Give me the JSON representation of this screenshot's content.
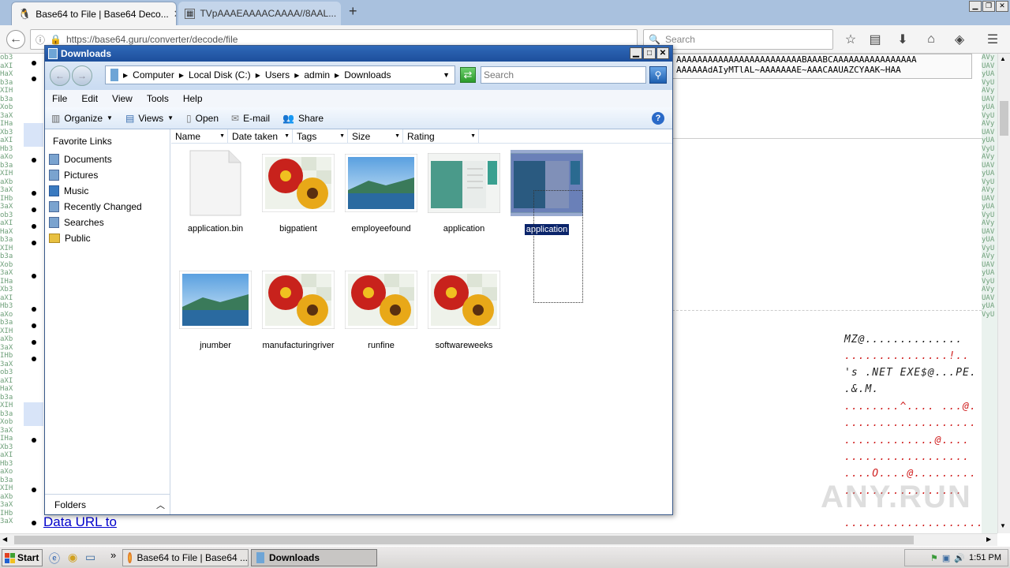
{
  "browser": {
    "tabs": [
      {
        "label": "Base64 to File | Base64 Deco...",
        "active": true
      },
      {
        "label": "TVpAAAEAAAACAAAA//8AAL...",
        "active": false
      }
    ],
    "new_tab_label": "+",
    "url": "https://base64.guru/converter/decode/file",
    "search_placeholder": "Search"
  },
  "page": {
    "left_col_text": "ob3aXIHaXb3aXIHb3aXob3aXIHaXb3aXIHb3aXob3aXIHaXb3aXIHb3aXob3aXIHaXb3aXIHb3aXob3aXIHaXb3aXIHb3aXob3aXIHaXb3aXIHb3aXob3aXIHaXb3aXIHb3aXob3aXIHaXb3aXIHb3aXob3aXIHaXb3aXIHb3aX",
    "right_col_text": "AVyUAVyUAVyUAVyUAVyUAVyUAVyUAVyUAVyUAVyUAVyUAVyUAVyUAVyUAVyUAVyUAVyUAVyUAVyUAVyUAVyUAVyUAVyUAVyU",
    "b64_line1": "AAAAAAAAAAAAAAAAAAAAAAAABAAABCAAAAAAAAAAAAAAAA",
    "b64_line2": "AAAAAAdAIyMTlAL~AAAAAAAE~AAACAAUAZCYAAK~HAA",
    "hex_lines": [
      "MZ@..............",
      "...............!..",
      "'s .NET EXE$@...PE.",
      ".&.M.",
      "........^....  ...@.",
      "...................",
      ".............@....",
      "..................",
      "....O....@.........",
      ".................",
      "...................."
    ],
    "data_url_link": "Data URL to",
    "watermark": "ANY.RUN"
  },
  "explorer": {
    "title": "Downloads",
    "breadcrumb": [
      "Computer",
      "Local Disk (C:)",
      "Users",
      "admin",
      "Downloads"
    ],
    "search_placeholder": "Search",
    "menu": [
      "File",
      "Edit",
      "View",
      "Tools",
      "Help"
    ],
    "toolbar": {
      "organize": "Organize",
      "views": "Views",
      "open": "Open",
      "email": "E-mail",
      "share": "Share"
    },
    "favorites_header": "Favorite Links",
    "favorites": [
      "Documents",
      "Pictures",
      "Music",
      "Recently Changed",
      "Searches",
      "Public"
    ],
    "folders_label": "Folders",
    "columns": [
      "Name",
      "Date taken",
      "Tags",
      "Size",
      "Rating"
    ],
    "files": [
      {
        "name": "application.bin",
        "thumb": "blank"
      },
      {
        "name": "bigpatient",
        "thumb": "flower"
      },
      {
        "name": "employeefound",
        "thumb": "landscape"
      },
      {
        "name": "application",
        "thumb": "window"
      },
      {
        "name": "application",
        "thumb": "window",
        "selected": true
      },
      {
        "name": "jnumber",
        "thumb": "landscape"
      },
      {
        "name": "manufacturingriver",
        "thumb": "flower"
      },
      {
        "name": "runfine",
        "thumb": "flower"
      },
      {
        "name": "softwareweeks",
        "thumb": "flower"
      }
    ]
  },
  "taskbar": {
    "start_label": "Start",
    "tasks": [
      {
        "label": "Base64 to File | Base64 ...",
        "active": false
      },
      {
        "label": "Downloads",
        "active": true
      }
    ],
    "clock": "1:51 PM"
  },
  "colors": {
    "title_bar": "#1d4f9c",
    "selection": "#0a246a",
    "hex_red": "#d02020"
  }
}
